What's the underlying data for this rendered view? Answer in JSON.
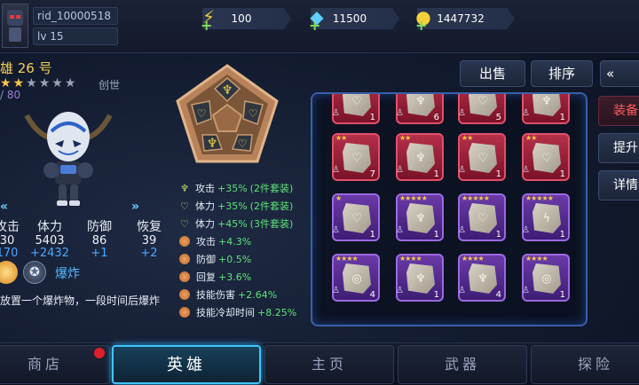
{
  "player": {
    "id": "rid_10000518",
    "level": "lv 15"
  },
  "resources": [
    {
      "name": "energy",
      "value": "100",
      "icon": "lightning-icon",
      "color": "#f5c83a"
    },
    {
      "name": "diamond",
      "value": "11500",
      "icon": "diamond-icon",
      "color": "#5fd0ff"
    },
    {
      "name": "gold",
      "value": "1447732",
      "icon": "gold-icon",
      "color": "#f5d03a"
    }
  ],
  "hero": {
    "name": "雄 26 号",
    "stars_on": 2,
    "stars_total": 6,
    "tag": "创世",
    "level_current": "/",
    "level_max": "80",
    "stats": [
      {
        "label": "攻击",
        "value": "30",
        "bonus": "170"
      },
      {
        "label": "体力",
        "value": "5403",
        "bonus": "+2432"
      },
      {
        "label": "防御",
        "value": "86",
        "bonus": "+1"
      },
      {
        "label": "恢复",
        "value": "39",
        "bonus": "+2"
      }
    ],
    "skill": {
      "name": "爆炸",
      "desc": "放置一个爆炸物，一段时间后爆炸"
    }
  },
  "set_bonuses": [
    {
      "icon": "sword-icon",
      "text": "攻击",
      "value": "+35%",
      "note": "(2件套装)"
    },
    {
      "icon": "heart-icon",
      "text": "体力",
      "value": "+35%",
      "note": "(2件套装)"
    },
    {
      "icon": "heart-icon",
      "text": "体力",
      "value": "+45%",
      "note": "(3件套装)"
    },
    {
      "icon": "orb-icon",
      "text": "攻击",
      "value": "+4.3%",
      "note": ""
    },
    {
      "icon": "orb-icon",
      "text": "防御",
      "value": "+0.5%",
      "note": ""
    },
    {
      "icon": "orb-icon",
      "text": "回复",
      "value": "+3.6%",
      "note": ""
    },
    {
      "icon": "orb-icon",
      "text": "技能伤害",
      "value": "+2.64%",
      "note": ""
    },
    {
      "icon": "orb-icon",
      "text": "技能冷却时间",
      "value": "+8.25%",
      "note": ""
    }
  ],
  "buttons": {
    "sell": "出售",
    "sort": "排序",
    "collapse": "«"
  },
  "side_tabs": [
    "装备",
    "提升",
    "详情"
  ],
  "inventory": [
    {
      "color": "red",
      "stars": "",
      "glyph": "♡",
      "count": "1"
    },
    {
      "color": "red",
      "stars": "",
      "glyph": "♆",
      "count": "6"
    },
    {
      "color": "red",
      "stars": "",
      "glyph": "♡",
      "count": "5"
    },
    {
      "color": "red",
      "stars": "",
      "glyph": "♆",
      "count": "1"
    },
    {
      "color": "red",
      "stars": "★★",
      "glyph": "♡",
      "count": "7"
    },
    {
      "color": "red",
      "stars": "★★",
      "glyph": "♆",
      "count": "1"
    },
    {
      "color": "red",
      "stars": "★★",
      "glyph": "♡",
      "count": "1"
    },
    {
      "color": "red",
      "stars": "★★",
      "glyph": "♡",
      "count": "1"
    },
    {
      "color": "purple",
      "stars": "★",
      "glyph": "♡",
      "count": "1"
    },
    {
      "color": "purple",
      "stars": "★★★★★",
      "glyph": "♆",
      "count": "1"
    },
    {
      "color": "purple",
      "stars": "★★★★★",
      "glyph": "♡",
      "count": "1"
    },
    {
      "color": "purple",
      "stars": "★★★★★",
      "glyph": "ϟ",
      "count": "1"
    },
    {
      "color": "purple",
      "stars": "★★★★",
      "glyph": "◎",
      "count": "4"
    },
    {
      "color": "purple",
      "stars": "★★★★",
      "glyph": "♆",
      "count": "1"
    },
    {
      "color": "purple",
      "stars": "★★★★",
      "glyph": "♆",
      "count": "4"
    },
    {
      "color": "purple",
      "stars": "★★★★",
      "glyph": "◎",
      "count": "1"
    }
  ],
  "nav": [
    {
      "label": "商店",
      "active": false
    },
    {
      "label": "英雄",
      "active": true
    },
    {
      "label": "主页",
      "active": false
    },
    {
      "label": "武器",
      "active": false
    },
    {
      "label": "探险",
      "active": false
    }
  ]
}
